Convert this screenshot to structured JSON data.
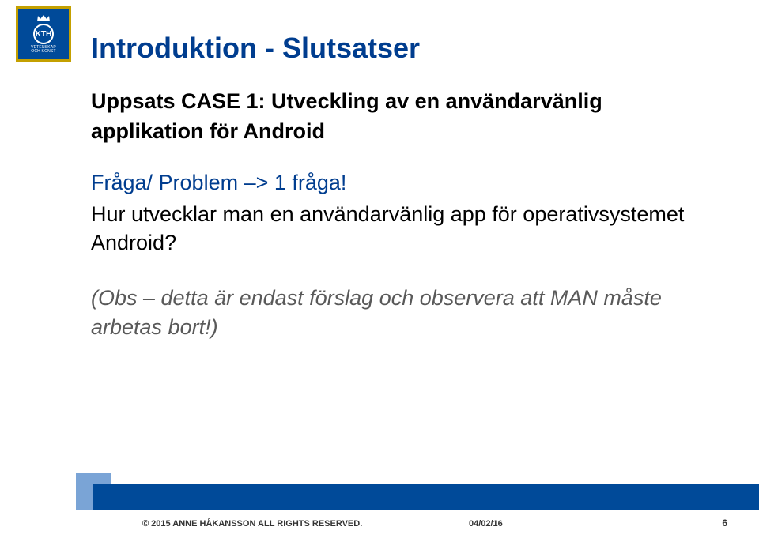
{
  "logo": {
    "abbr": "KTH",
    "sub1": "VETENSKAP",
    "sub2": "OCH KONST"
  },
  "title": "Introduktion - Slutsatser",
  "subtitle": "Uppsats CASE 1: Utveckling av en användarvänlig applikation för Android",
  "question_label": "Fråga/ Problem –> 1 fråga!",
  "question_text": "Hur utvecklar man en användarvänlig app för operativsystemet Android?",
  "note": "(Obs – detta är endast förslag och observera att MAN måste arbetas bort!)",
  "footer": {
    "copyright": "© 2015 ANNE HÅKANSSON ALL RIGHTS RESERVED.",
    "date": "04/02/16",
    "page": "6"
  }
}
